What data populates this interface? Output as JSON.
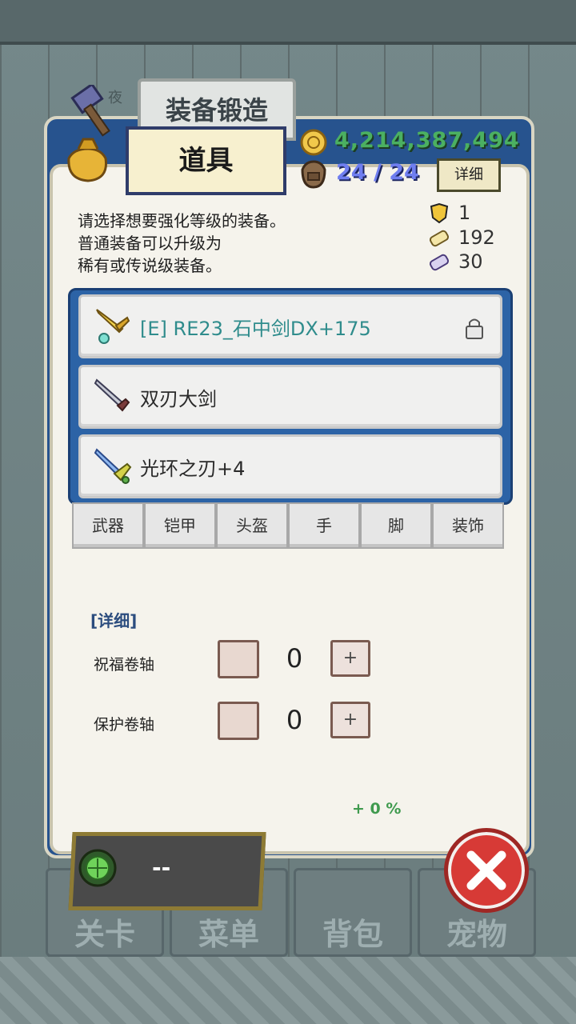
{
  "background": {
    "top_nav_text": "夜",
    "bottom_tabs": [
      "关卡",
      "菜单",
      "背包",
      "宠物"
    ]
  },
  "header": {
    "title": "装备锻造",
    "active_tab": "道具",
    "gold": "4,214,387,494",
    "bag_capacity": "24 / 24",
    "detail_button": "详细"
  },
  "instructions": "请选择想要强化等级的装备。\n普通装备可以升级为\n稀有或传说级装备。",
  "resources": [
    {
      "icon": "gold-shield-icon",
      "count": "1"
    },
    {
      "icon": "gold-scroll-icon",
      "count": "192"
    },
    {
      "icon": "purple-scroll-icon",
      "count": "30"
    }
  ],
  "equipment": [
    {
      "name": "[E] RE23_石中剑DX+175",
      "icon": "gold-sword-icon",
      "locked": true,
      "color": "#2f8c8c"
    },
    {
      "name": "双刃大剑",
      "icon": "steel-sword-icon",
      "locked": false,
      "color": "#2a2a2a"
    },
    {
      "name": "光环之刃+4",
      "icon": "blue-sword-icon",
      "locked": false,
      "color": "#2a2a2a"
    }
  ],
  "categories": [
    "武器",
    "铠甲",
    "头盔",
    "手",
    "脚",
    "装饰"
  ],
  "details": {
    "heading": "[详细]",
    "blessing_label": "祝福卷轴",
    "blessing_count": "0",
    "protection_label": "保护卷轴",
    "protection_count": "0",
    "plus_symbol": "+",
    "bonus": "+ 0 %"
  },
  "forge_button_label": "--",
  "colors": {
    "panel_blue": "#27538e",
    "panel_cream": "#f5f3ec",
    "gold_text": "#4bb061",
    "capacity_text": "#6f7ef0",
    "close_red": "#d73a36"
  }
}
